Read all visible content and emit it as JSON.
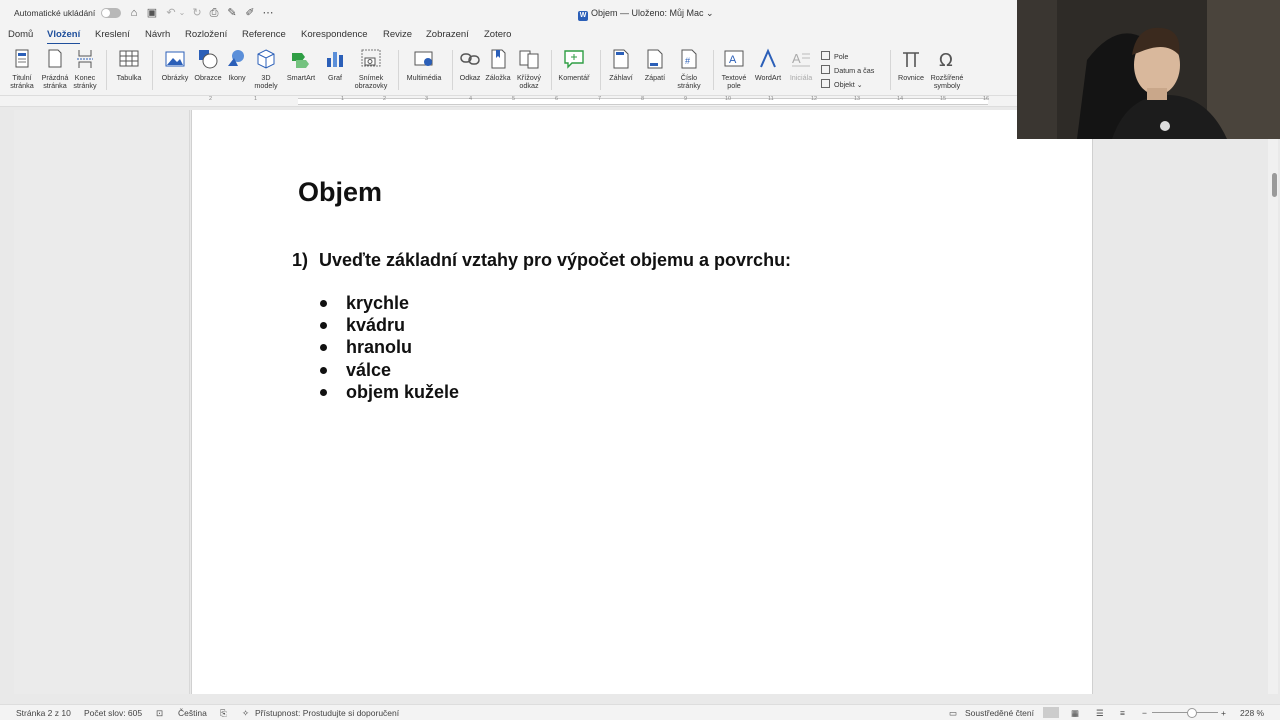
{
  "titlebar": {
    "autosave_label": "Automatické ukládání",
    "doc_title": "Objem — Uloženo: Můj Mac ⌄"
  },
  "tabs": [
    {
      "label": "Domů"
    },
    {
      "label": "Vložení",
      "active": true
    },
    {
      "label": "Kreslení"
    },
    {
      "label": "Návrh"
    },
    {
      "label": "Rozložení"
    },
    {
      "label": "Reference"
    },
    {
      "label": "Korespondence"
    },
    {
      "label": "Revize"
    },
    {
      "label": "Zobrazení"
    },
    {
      "label": "Zotero"
    }
  ],
  "ribbon": {
    "titulni": "Titulní stránka",
    "prazdna": "Prázdná stránka",
    "konec": "Konec stránky",
    "tabulka": "Tabulka",
    "obrazky": "Obrázky",
    "obrazce": "Obrazce",
    "ikony": "Ikony",
    "modely": "3D modely",
    "smartart": "SmartArt",
    "graf": "Graf",
    "snimek": "Snímek obrazovky",
    "multimedia": "Multimédia",
    "odkaz": "Odkaz",
    "zalozka": "Záložka",
    "krizovy": "Křížový odkaz",
    "komentar": "Komentář",
    "zahlavi": "Záhlaví",
    "zapati": "Zápatí",
    "cislo": "Číslo stránky",
    "textove": "Textové pole",
    "wordart": "WordArt",
    "inicial": "Iniciála",
    "pole": "Pole",
    "datum": "Datum a čas",
    "objekt": "Objekt",
    "rovnice": "Rovnice",
    "symboly": "Rozšířené symboly"
  },
  "document": {
    "heading": "Objem",
    "question_number": "1)",
    "question_text": "Uveďte základní vztahy pro výpočet objemu a povrchu:",
    "bullets": [
      "krychle",
      "kvádru",
      "hranolu",
      "válce",
      "objem kužele"
    ]
  },
  "statusbar": {
    "page": "Stránka 2 z 10",
    "words": "Počet slov: 605",
    "language": "Čeština",
    "accessibility": "Přístupnost: Prostudujte si doporučení",
    "focus": "Soustředěné čtení",
    "zoom": "228 %"
  },
  "ruler_numbers": [
    "2",
    "1",
    "1",
    "2",
    "3",
    "4",
    "5",
    "6",
    "7",
    "8",
    "9",
    "10",
    "11",
    "12",
    "13",
    "14",
    "15",
    "16"
  ]
}
